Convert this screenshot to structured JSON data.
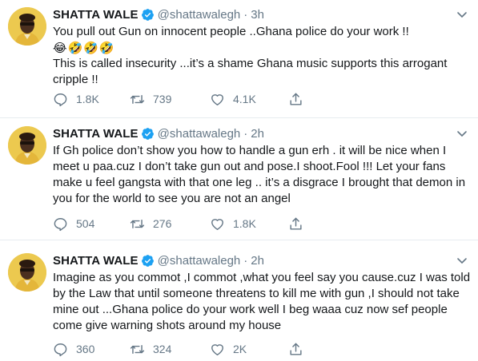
{
  "tweets": [
    {
      "name": "SHATTA WALE",
      "handle": "@shattawalegh",
      "dot": "·",
      "time": "3h",
      "lines": [
        "You pull out Gun on innocent people ..Ghana police do your work !!",
        "😂🤣🤣🤣",
        "This is called insecurity ...it’s a shame Ghana music supports this arrogant",
        "cripple !!"
      ],
      "replies": "1.8K",
      "retweets": "739",
      "likes": "4.1K"
    },
    {
      "name": "SHATTA WALE",
      "handle": "@shattawalegh",
      "dot": "·",
      "time": "2h",
      "lines": [
        "If Gh police don’t show you how to handle a gun erh . it will be nice when I",
        "meet u paa.cuz I don’t take gun out and pose.I shoot.Fool !!! Let your fans",
        "make u feel gangsta with that one leg .. it’s a disgrace I brought that demon in",
        "you for the world to see you are not an angel"
      ],
      "replies": "504",
      "retweets": "276",
      "likes": "1.8K"
    },
    {
      "name": "SHATTA WALE",
      "handle": "@shattawalegh",
      "dot": "·",
      "time": "2h",
      "lines": [
        "Imagine as you commot ,I commot ,what you feel say you cause.cuz I was told",
        "by the Law that until someone threatens to kill me with gun  ,I should not take",
        "mine out ...Ghana police do your work well I beg waaa cuz now sef people",
        "come give warning shots around my house"
      ],
      "replies": "360",
      "retweets": "324",
      "likes": "2K"
    }
  ],
  "colors": {
    "verified": "#1da1f2",
    "icon_gray": "#657786",
    "text": "#14171a",
    "divider": "#e6ecf0"
  },
  "icons": {
    "reply": "reply-icon",
    "retweet": "retweet-icon",
    "like": "like-icon",
    "share": "share-icon",
    "verified": "verified-badge-icon",
    "more": "chevron-down-icon"
  }
}
